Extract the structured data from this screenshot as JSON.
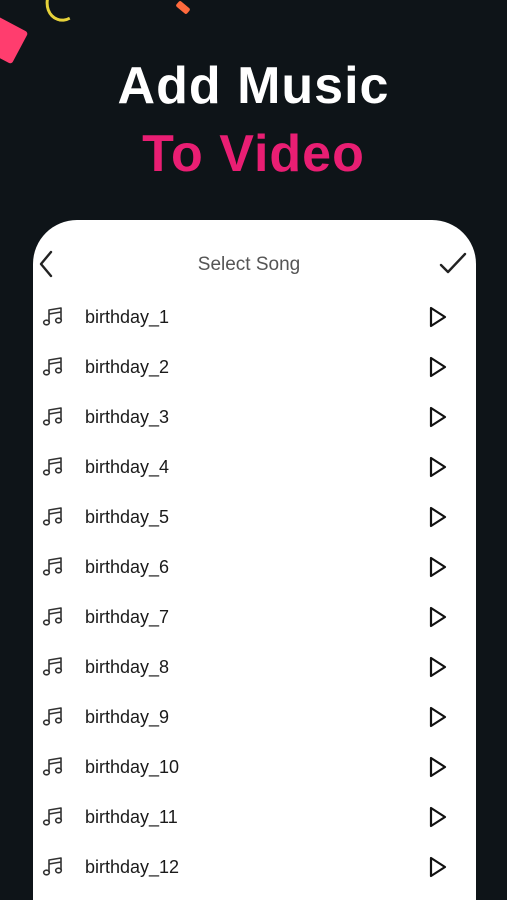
{
  "colors": {
    "background": "#0e1418",
    "accent": "#e91e73",
    "sheet": "#ffffff",
    "deco_pink": "#ff3d6e",
    "deco_yellow": "#e6d23a",
    "deco_orange": "#ff6a3d"
  },
  "hero": {
    "line1": "Add Music",
    "line2": "To Video"
  },
  "sheet": {
    "title": "Select Song",
    "back_icon": "chevron-left-icon",
    "confirm_icon": "checkmark-icon"
  },
  "songs": [
    {
      "name": "birthday_1",
      "icon": "music-note-icon",
      "action_icon": "play-icon"
    },
    {
      "name": "birthday_2",
      "icon": "music-note-icon",
      "action_icon": "play-icon"
    },
    {
      "name": "birthday_3",
      "icon": "music-note-icon",
      "action_icon": "play-icon"
    },
    {
      "name": "birthday_4",
      "icon": "music-note-icon",
      "action_icon": "play-icon"
    },
    {
      "name": "birthday_5",
      "icon": "music-note-icon",
      "action_icon": "play-icon"
    },
    {
      "name": "birthday_6",
      "icon": "music-note-icon",
      "action_icon": "play-icon"
    },
    {
      "name": "birthday_7",
      "icon": "music-note-icon",
      "action_icon": "play-icon"
    },
    {
      "name": "birthday_8",
      "icon": "music-note-icon",
      "action_icon": "play-icon"
    },
    {
      "name": "birthday_9",
      "icon": "music-note-icon",
      "action_icon": "play-icon"
    },
    {
      "name": "birthday_10",
      "icon": "music-note-icon",
      "action_icon": "play-icon"
    },
    {
      "name": "birthday_11",
      "icon": "music-note-icon",
      "action_icon": "play-icon"
    },
    {
      "name": "birthday_12",
      "icon": "music-note-icon",
      "action_icon": "play-icon"
    }
  ]
}
